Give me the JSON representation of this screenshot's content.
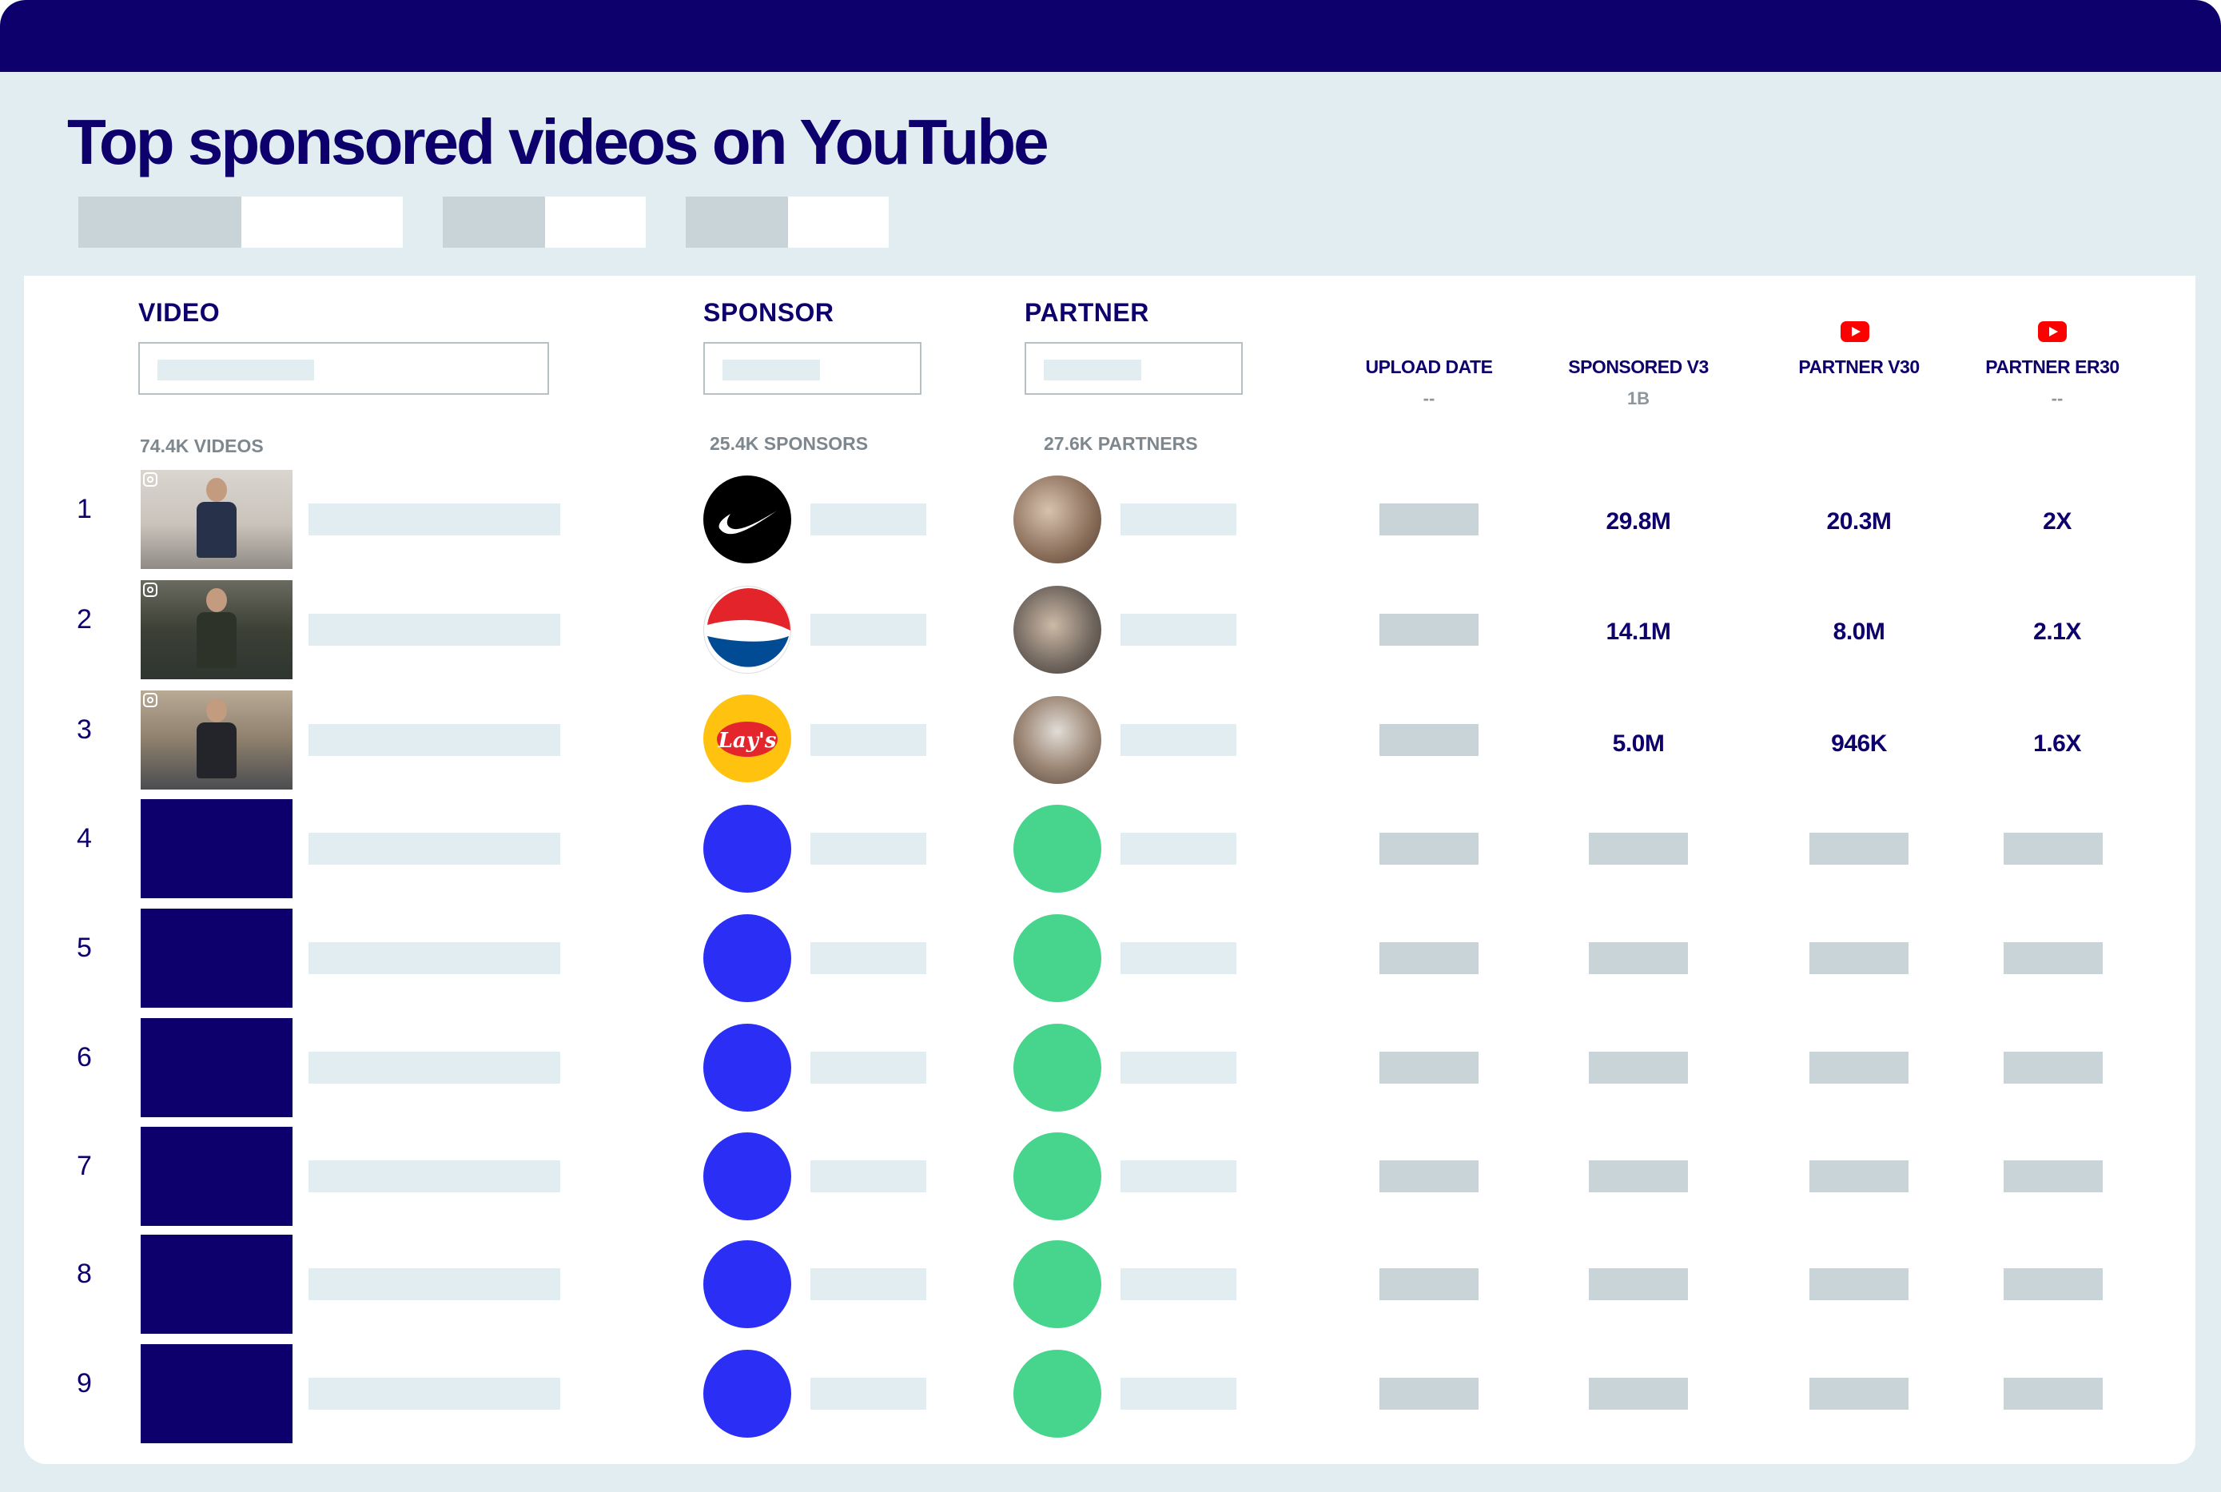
{
  "title": "Top sponsored videos on YouTube",
  "columns": {
    "video": "VIDEO",
    "sponsor": "SPONSOR",
    "partner": "PARTNER",
    "upload_date": "UPLOAD DATE",
    "upload_date_sub": "--",
    "sponsored_v3": "SPONSORED V3",
    "sponsored_v3_sub": "1B",
    "partner_v30": "PARTNER V30",
    "partner_er30": "PARTNER ER30",
    "partner_er30_sub": "--"
  },
  "counts": {
    "videos": "74.4K VIDEOS",
    "sponsors": "25.4K SPONSORS",
    "partners": "27.6K PARTNERS"
  },
  "rows": [
    {
      "rank": "1",
      "sponsor_icon": "nike-logo-icon",
      "partner_icon": "creator-avatar-icon",
      "sponsored_v3": "29.8M",
      "partner_v30": "20.3M",
      "partner_er30": "2X"
    },
    {
      "rank": "2",
      "sponsor_icon": "pepsi-logo-icon",
      "partner_icon": "creator-avatar-icon",
      "sponsored_v3": "14.1M",
      "partner_v30": "8.0M",
      "partner_er30": "2.1X"
    },
    {
      "rank": "3",
      "sponsor_icon": "lays-logo-icon",
      "partner_icon": "creator-avatar-icon",
      "sponsored_v3": "5.0M",
      "partner_v30": "946K",
      "partner_er30": "1.6X"
    },
    {
      "rank": "4"
    },
    {
      "rank": "5"
    },
    {
      "rank": "6"
    },
    {
      "rank": "7"
    },
    {
      "rank": "8"
    },
    {
      "rank": "9"
    }
  ],
  "lays_text": "Lay's",
  "colors": {
    "navy": "#0e006c",
    "blue": "#2b2ef5",
    "green": "#47d48c",
    "youtube_red": "#ff0000"
  }
}
